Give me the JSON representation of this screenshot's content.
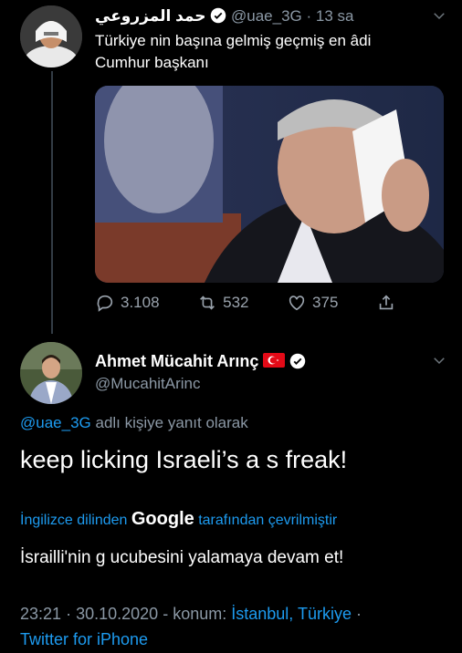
{
  "tweet1": {
    "author_name": "حمد المزروعي",
    "handle": "@uae_3G",
    "time": "13 sa",
    "text_line1": "Türkiye nin  başına gelmiş geçmiş en  âdi",
    "text_line2": "Cumhur başkanı",
    "actions": {
      "replies": "3.108",
      "retweets": "532",
      "likes": "375"
    }
  },
  "tweet2": {
    "author_name": "Ahmet Mücahit Arınç",
    "handle": "@MucahitArinc",
    "reply_to_handle": "@uae_3G",
    "reply_to_suffix": "adlı kişiye yanıt olarak",
    "text": "keep licking Israeli’s a  s freak!",
    "translation": {
      "prefix": "İngilizce dilinden",
      "brand": "Google",
      "suffix": "tarafından çevrilmiştir",
      "text": "İsrailli'nin g  ucubesini yalamaya devam et!"
    },
    "meta": {
      "time": "23:21",
      "date": "30.10.2020",
      "location_label": "konum:",
      "location": "İstanbul, Türkiye",
      "source": "Twitter for iPhone"
    }
  },
  "colors": {
    "background": "#000000",
    "accent": "#1d9bf0",
    "muted": "#8b98a5"
  },
  "icons": [
    "verified-badge-icon",
    "chevron-down-icon",
    "reply-icon",
    "retweet-icon",
    "like-icon",
    "share-icon",
    "turkey-flag-icon"
  ]
}
